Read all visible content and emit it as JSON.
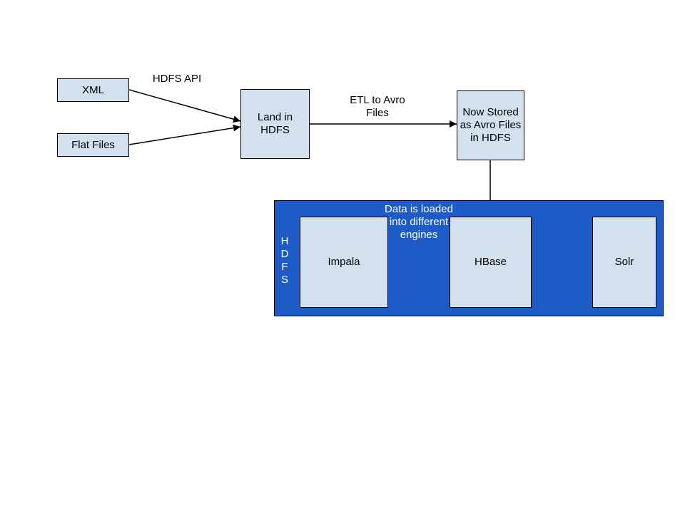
{
  "nodes": {
    "xml": "XML",
    "flat_files": "Flat Files",
    "land_in_hdfs": "Land in\nHDFS",
    "now_stored": "Now Stored as Avro Files in HDFS",
    "impala": "Impala",
    "hbase": "HBase",
    "solr": "Solr"
  },
  "edges": {
    "hdfs_api": "HDFS API",
    "etl_to_avro": "ETL to Avro\nFiles",
    "data_loaded": "Data is loaded into different engines"
  },
  "container": {
    "label_vertical": "HDFS"
  },
  "colors": {
    "node_fill": "#d3e0ee",
    "container_fill": "#1e5bc6"
  }
}
